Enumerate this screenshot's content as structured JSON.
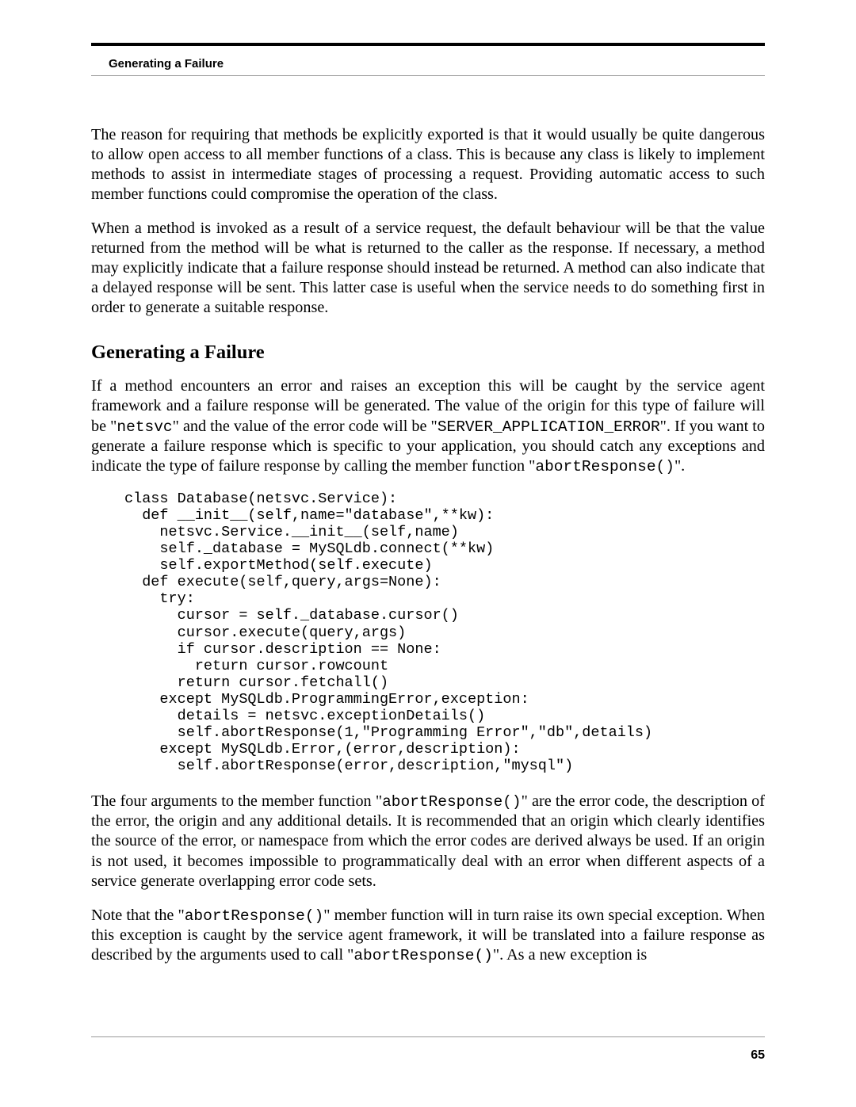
{
  "header": {
    "running_head": "Generating a Failure"
  },
  "paragraphs": {
    "p1": "The reason for requiring that methods be explicitly exported is that it would usually be quite dangerous to allow open access to all member functions of a class. This is because any class is likely to implement methods to assist in intermediate stages of processing a request. Providing automatic access to such member functions could compromise the operation of the class.",
    "p2": "When a method is invoked as a result of a service request, the default behaviour will be that the value returned from the method will be what is returned to the caller as the response. If necessary, a method may explicitly indicate that a failure response should instead be returned. A method can also indicate that a delayed response will be sent. This latter case is useful when the service needs to do something first in order to generate a suitable response.",
    "p3_pre": "If a method encounters an error and raises an exception this will be caught by the service agent framework and a failure response will be generated. The value of the origin for this type of failure will be \"",
    "p3_code1": "netsvc",
    "p3_mid1": "\" and the value of the error code will be \"",
    "p3_code2": "SERVER_APPLICATION_ERROR",
    "p3_mid2": "\". If you want to generate a failure response which is specific to your application, you should catch any exceptions and indicate the type of failure response by calling the member function \"",
    "p3_code3": "abortResponse()",
    "p3_end": "\".",
    "p4_pre": "The four arguments to the member function \"",
    "p4_code1": "abortResponse()",
    "p4_post": "\" are the error code, the description of the error, the origin and any additional details. It is recommended that an origin which clearly identifies the source of the error, or namespace from which the error codes are derived always be used. If an origin is not used, it becomes impossible to programmatically deal with an error when different aspects of a service generate overlapping error code sets.",
    "p5_pre": "Note that the \"",
    "p5_code1": "abortResponse()",
    "p5_mid": "\" member function will in turn raise its own special exception. When this exception is caught by the service agent framework, it will be translated into a failure response as described by the arguments used to call \"",
    "p5_code2": "abortResponse()",
    "p5_end": "\". As a new exception is"
  },
  "section_heading": "Generating a Failure",
  "code_block": "class Database(netsvc.Service):\n  def __init__(self,name=\"database\",**kw):\n    netsvc.Service.__init__(self,name)\n    self._database = MySQLdb.connect(**kw)\n    self.exportMethod(self.execute)\n  def execute(self,query,args=None):\n    try:\n      cursor = self._database.cursor()\n      cursor.execute(query,args)\n      if cursor.description == None:\n        return cursor.rowcount\n      return cursor.fetchall()\n    except MySQLdb.ProgrammingError,exception:\n      details = netsvc.exceptionDetails()\n      self.abortResponse(1,\"Programming Error\",\"db\",details)\n    except MySQLdb.Error,(error,description):\n      self.abortResponse(error,description,\"mysql\")",
  "page_number": "65"
}
